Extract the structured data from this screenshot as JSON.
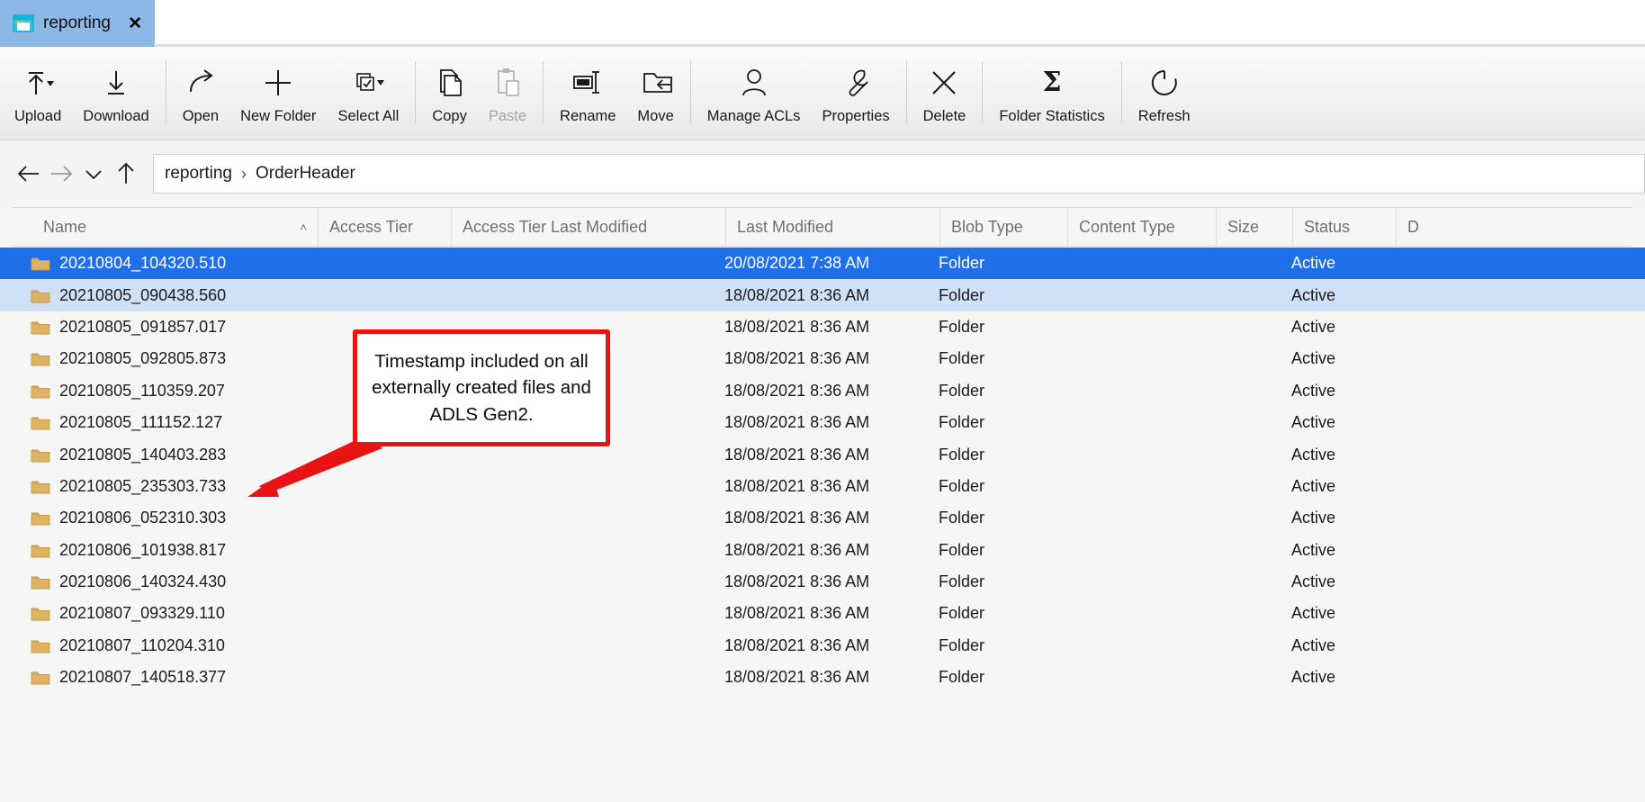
{
  "window": {
    "tab": {
      "label": "reporting",
      "icon": "window-folder-icon",
      "close_label": "✕"
    }
  },
  "toolbar": {
    "items": [
      {
        "label": "Upload",
        "icon": "upload-arrow-icon",
        "has_dropdown": true,
        "disabled": false
      },
      {
        "label": "Download",
        "icon": "download-arrow-icon",
        "has_dropdown": false,
        "disabled": false
      },
      {
        "label": "Open",
        "icon": "open-arrow-icon",
        "has_dropdown": false,
        "disabled": false
      },
      {
        "label": "New Folder",
        "icon": "plus-icon",
        "has_dropdown": false,
        "disabled": false
      },
      {
        "label": "Select All",
        "icon": "select-all-checkbox-icon",
        "has_dropdown": true,
        "disabled": false
      },
      {
        "label": "Copy",
        "icon": "copy-pages-icon",
        "has_dropdown": false,
        "disabled": false
      },
      {
        "label": "Paste",
        "icon": "clipboard-paste-icon",
        "has_dropdown": false,
        "disabled": true
      },
      {
        "label": "Rename",
        "icon": "rename-textfield-icon",
        "has_dropdown": false,
        "disabled": false
      },
      {
        "label": "Move",
        "icon": "move-folder-arrow-icon",
        "has_dropdown": false,
        "disabled": false
      },
      {
        "label": "Manage ACLs",
        "icon": "person-icon",
        "has_dropdown": false,
        "disabled": false
      },
      {
        "label": "Properties",
        "icon": "wrench-icon",
        "has_dropdown": false,
        "disabled": false
      },
      {
        "label": "Delete",
        "icon": "x-cross-icon",
        "has_dropdown": false,
        "disabled": false
      },
      {
        "label": "Folder Statistics",
        "icon": "sigma-icon",
        "has_dropdown": false,
        "disabled": false
      },
      {
        "label": "Refresh",
        "icon": "refresh-circular-arrow-icon",
        "has_dropdown": false,
        "disabled": false
      }
    ],
    "separators_after": [
      1,
      4,
      6,
      8,
      10,
      11,
      12
    ]
  },
  "navigation": {
    "back": "back-arrow-icon",
    "forward": "forward-arrow-icon",
    "recent": "chevron-down-icon",
    "up": "up-arrow-icon",
    "breadcrumb": [
      "reporting",
      "OrderHeader"
    ],
    "separator": "›"
  },
  "table": {
    "columns": [
      {
        "label": "Name",
        "sorted": "asc",
        "caret": "˄"
      },
      {
        "label": "Access Tier"
      },
      {
        "label": "Access Tier Last Modified"
      },
      {
        "label": "Last Modified"
      },
      {
        "label": "Blob Type"
      },
      {
        "label": "Content Type"
      },
      {
        "label": "Size"
      },
      {
        "label": "Status"
      },
      {
        "label": "D"
      }
    ],
    "rows": [
      {
        "name": "20210804_104320.510",
        "access_tier": "",
        "access_tier_last_modified": "",
        "last_modified": "20/08/2021 7:38 AM",
        "blob_type": "Folder",
        "content_type": "",
        "size": "",
        "status": "Active",
        "state": "selected"
      },
      {
        "name": "20210805_090438.560",
        "access_tier": "",
        "access_tier_last_modified": "",
        "last_modified": "18/08/2021 8:36 AM",
        "blob_type": "Folder",
        "content_type": "",
        "size": "",
        "status": "Active",
        "state": "hover"
      },
      {
        "name": "20210805_091857.017",
        "access_tier": "",
        "access_tier_last_modified": "",
        "last_modified": "18/08/2021 8:36 AM",
        "blob_type": "Folder",
        "content_type": "",
        "size": "",
        "status": "Active",
        "state": "normal"
      },
      {
        "name": "20210805_092805.873",
        "access_tier": "",
        "access_tier_last_modified": "",
        "last_modified": "18/08/2021 8:36 AM",
        "blob_type": "Folder",
        "content_type": "",
        "size": "",
        "status": "Active",
        "state": "normal"
      },
      {
        "name": "20210805_110359.207",
        "access_tier": "",
        "access_tier_last_modified": "",
        "last_modified": "18/08/2021 8:36 AM",
        "blob_type": "Folder",
        "content_type": "",
        "size": "",
        "status": "Active",
        "state": "normal"
      },
      {
        "name": "20210805_111152.127",
        "access_tier": "",
        "access_tier_last_modified": "",
        "last_modified": "18/08/2021 8:36 AM",
        "blob_type": "Folder",
        "content_type": "",
        "size": "",
        "status": "Active",
        "state": "normal"
      },
      {
        "name": "20210805_140403.283",
        "access_tier": "",
        "access_tier_last_modified": "",
        "last_modified": "18/08/2021 8:36 AM",
        "blob_type": "Folder",
        "content_type": "",
        "size": "",
        "status": "Active",
        "state": "normal"
      },
      {
        "name": "20210805_235303.733",
        "access_tier": "",
        "access_tier_last_modified": "",
        "last_modified": "18/08/2021 8:36 AM",
        "blob_type": "Folder",
        "content_type": "",
        "size": "",
        "status": "Active",
        "state": "normal"
      },
      {
        "name": "20210806_052310.303",
        "access_tier": "",
        "access_tier_last_modified": "",
        "last_modified": "18/08/2021 8:36 AM",
        "blob_type": "Folder",
        "content_type": "",
        "size": "",
        "status": "Active",
        "state": "normal"
      },
      {
        "name": "20210806_101938.817",
        "access_tier": "",
        "access_tier_last_modified": "",
        "last_modified": "18/08/2021 8:36 AM",
        "blob_type": "Folder",
        "content_type": "",
        "size": "",
        "status": "Active",
        "state": "normal"
      },
      {
        "name": "20210806_140324.430",
        "access_tier": "",
        "access_tier_last_modified": "",
        "last_modified": "18/08/2021 8:36 AM",
        "blob_type": "Folder",
        "content_type": "",
        "size": "",
        "status": "Active",
        "state": "normal"
      },
      {
        "name": "20210807_093329.110",
        "access_tier": "",
        "access_tier_last_modified": "",
        "last_modified": "18/08/2021 8:36 AM",
        "blob_type": "Folder",
        "content_type": "",
        "size": "",
        "status": "Active",
        "state": "normal"
      },
      {
        "name": "20210807_110204.310",
        "access_tier": "",
        "access_tier_last_modified": "",
        "last_modified": "18/08/2021 8:36 AM",
        "blob_type": "Folder",
        "content_type": "",
        "size": "",
        "status": "Active",
        "state": "normal"
      },
      {
        "name": "20210807_140518.377",
        "access_tier": "",
        "access_tier_last_modified": "",
        "last_modified": "18/08/2021 8:36 AM",
        "blob_type": "Folder",
        "content_type": "",
        "size": "",
        "status": "Active",
        "state": "normal"
      }
    ]
  },
  "annotation": {
    "text": "Timestamp included on all externally created files and ADLS Gen2.",
    "border_color": "#e81414",
    "arrow_color": "#e81414"
  },
  "colors": {
    "selection_blue": "#1f6fea",
    "hover_blue": "#cfe0f7",
    "tab_blue": "#8cb8e8",
    "folder_gold": "#dfb264"
  }
}
